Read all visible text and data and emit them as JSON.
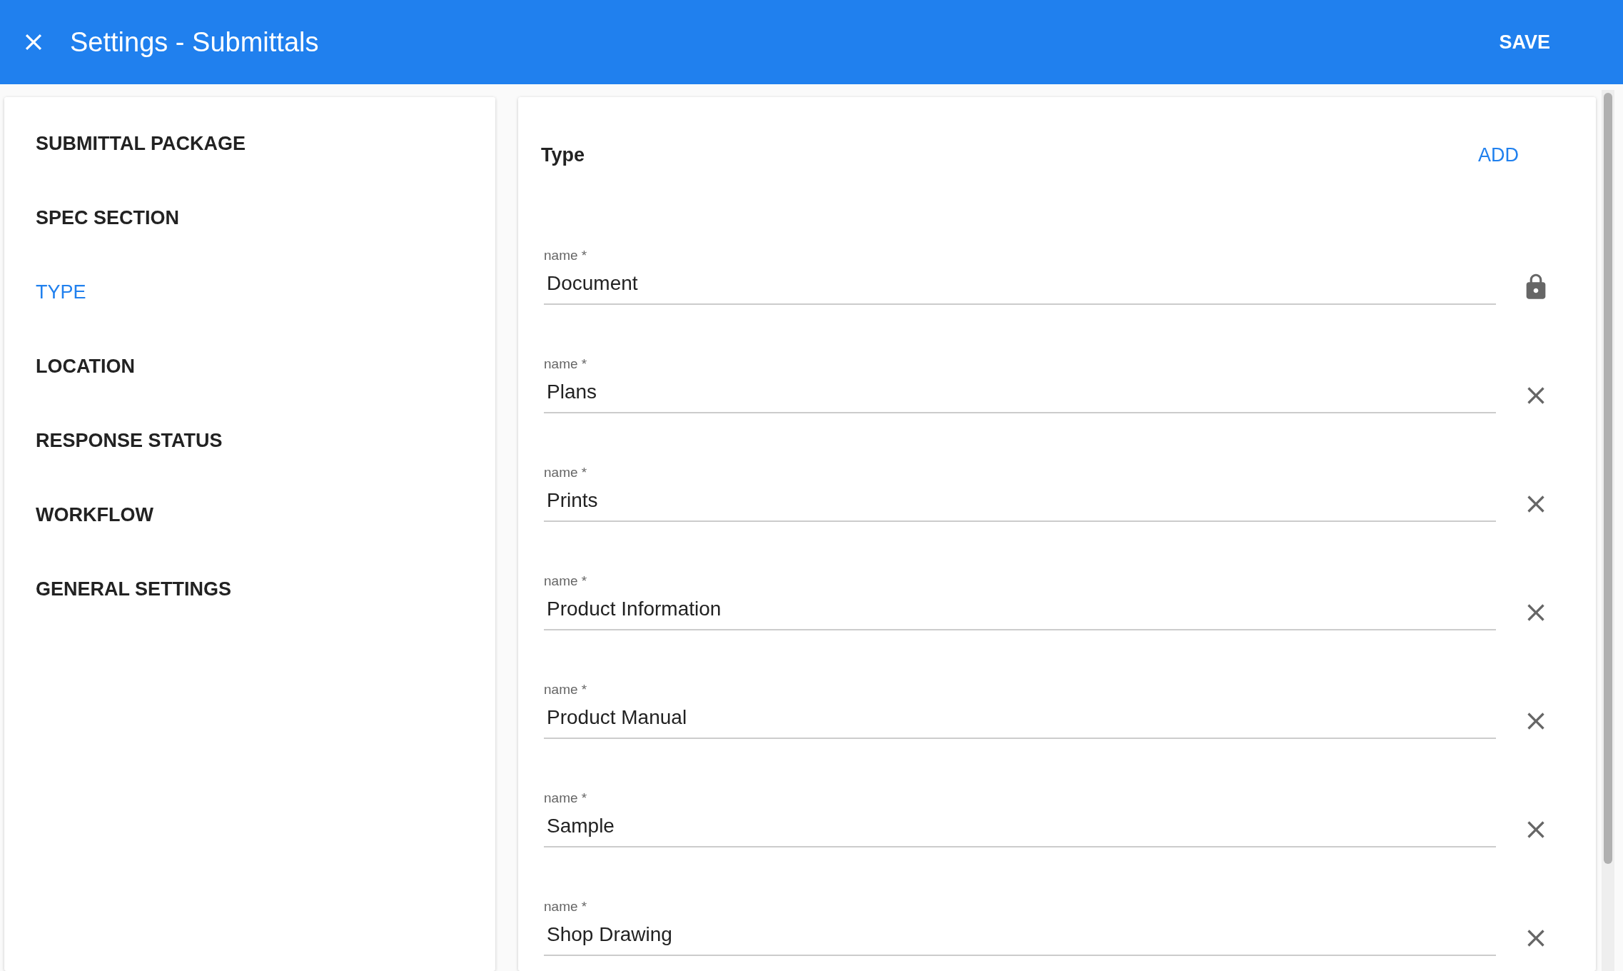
{
  "header": {
    "title": "Settings - Submittals",
    "action": "SAVE"
  },
  "sidebar": {
    "items": [
      {
        "label": "SUBMITTAL PACKAGE",
        "selected": false
      },
      {
        "label": "SPEC SECTION",
        "selected": false
      },
      {
        "label": "TYPE",
        "selected": true
      },
      {
        "label": "LOCATION",
        "selected": false
      },
      {
        "label": "RESPONSE STATUS",
        "selected": false
      },
      {
        "label": "WORKFLOW",
        "selected": false
      },
      {
        "label": "GENERAL SETTINGS",
        "selected": false
      }
    ]
  },
  "panel": {
    "title": "Type",
    "action": "ADD",
    "fields": [
      {
        "label": "name *",
        "value": "Document",
        "kind": "locked"
      },
      {
        "label": "name *",
        "value": "Plans",
        "kind": "removable"
      },
      {
        "label": "name *",
        "value": "Prints",
        "kind": "removable"
      },
      {
        "label": "name *",
        "value": "Product Information",
        "kind": "removable"
      },
      {
        "label": "name *",
        "value": "Product Manual",
        "kind": "removable"
      },
      {
        "label": "name *",
        "value": "Sample",
        "kind": "removable"
      },
      {
        "label": "name *",
        "value": "Shop Drawing",
        "kind": "removable"
      }
    ]
  }
}
